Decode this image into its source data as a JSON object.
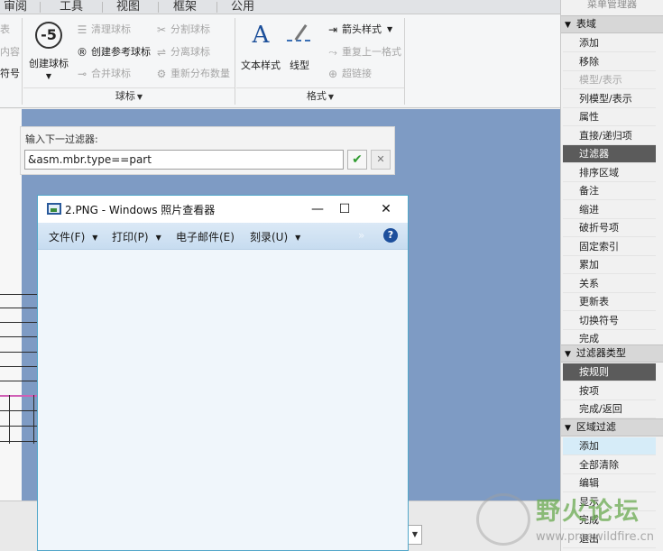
{
  "ribbon": {
    "tabs": [
      "审阅",
      "工具",
      "视图",
      "框架",
      "公用"
    ],
    "partial_group": {
      "items": [
        "表",
        "内容",
        "符号"
      ]
    },
    "balloon_group": {
      "label": "球标",
      "create_balloon": "创建球标",
      "create_balloon_glyph": "-5",
      "clean_balloon": "清理球标",
      "create_ref_balloon": "创建参考球标",
      "merge_balloon": "合并球标",
      "split_balloon": "分割球标",
      "detach_balloon": "分离球标",
      "redistribute_qty": "重新分布数量"
    },
    "format_group": {
      "label": "格式",
      "text_style": "文本样式",
      "text_style_glyph": "A",
      "line_style": "线型",
      "arrow_style": "箭头样式",
      "repeat_last_format": "重复上一格式",
      "hyperlink": "超链接"
    }
  },
  "filter_dialog": {
    "label": "输入下一过滤器:",
    "value": "&asm.mbr.type==part",
    "ok_glyph": "✔",
    "cancel_glyph": "✕"
  },
  "photo_viewer": {
    "title": "2.PNG - Windows 照片查看器",
    "controls": {
      "minimize": "—",
      "maximize": "☐",
      "close": "✕"
    },
    "menus": [
      {
        "label": "文件(F)"
      },
      {
        "label": "打印(P)"
      },
      {
        "label": "电子邮件(E)"
      },
      {
        "label": "刻录(U)"
      }
    ],
    "more_glyph": "»",
    "help_glyph": "?"
  },
  "menu_manager": {
    "title": "菜单管理器",
    "sections": [
      {
        "header": "表域",
        "items": [
          {
            "label": "添加",
            "state": "normal"
          },
          {
            "label": "移除",
            "state": "normal"
          },
          {
            "label": "模型/表示",
            "state": "dim"
          },
          {
            "label": "列模型/表示",
            "state": "normal"
          },
          {
            "label": "属性",
            "state": "normal"
          },
          {
            "label": "直接/递归项",
            "state": "normal"
          },
          {
            "label": "过滤器",
            "state": "selected"
          },
          {
            "label": "排序区域",
            "state": "normal"
          },
          {
            "label": "备注",
            "state": "normal"
          },
          {
            "label": "缩进",
            "state": "normal"
          },
          {
            "label": "破折号项",
            "state": "normal"
          },
          {
            "label": "固定索引",
            "state": "normal"
          },
          {
            "label": "累加",
            "state": "normal"
          },
          {
            "label": "关系",
            "state": "normal"
          },
          {
            "label": "更新表",
            "state": "normal"
          },
          {
            "label": "切换符号",
            "state": "normal"
          },
          {
            "label": "完成",
            "state": "normal"
          }
        ]
      },
      {
        "header": "过滤器类型",
        "items": [
          {
            "label": "按规则",
            "state": "selected"
          },
          {
            "label": "按项",
            "state": "normal"
          },
          {
            "label": "完成/返回",
            "state": "normal"
          }
        ]
      },
      {
        "header": "区域过滤",
        "items": [
          {
            "label": "添加",
            "state": "hover"
          },
          {
            "label": "全部清除",
            "state": "normal"
          },
          {
            "label": "编辑",
            "state": "normal"
          },
          {
            "label": "显示",
            "state": "normal"
          },
          {
            "label": "完成",
            "state": "normal"
          },
          {
            "label": "退出",
            "state": "normal"
          }
        ]
      }
    ]
  },
  "watermark": {
    "cn": "野火论坛",
    "url": "www.proewildfire.cn"
  },
  "colors": {
    "canvas": "#7e9bc4",
    "selected_item": "#5b5b5b",
    "hover_item": "#d6ecf8",
    "viewer_border": "#52a7c9",
    "ok_green": "#2f9b2f"
  }
}
